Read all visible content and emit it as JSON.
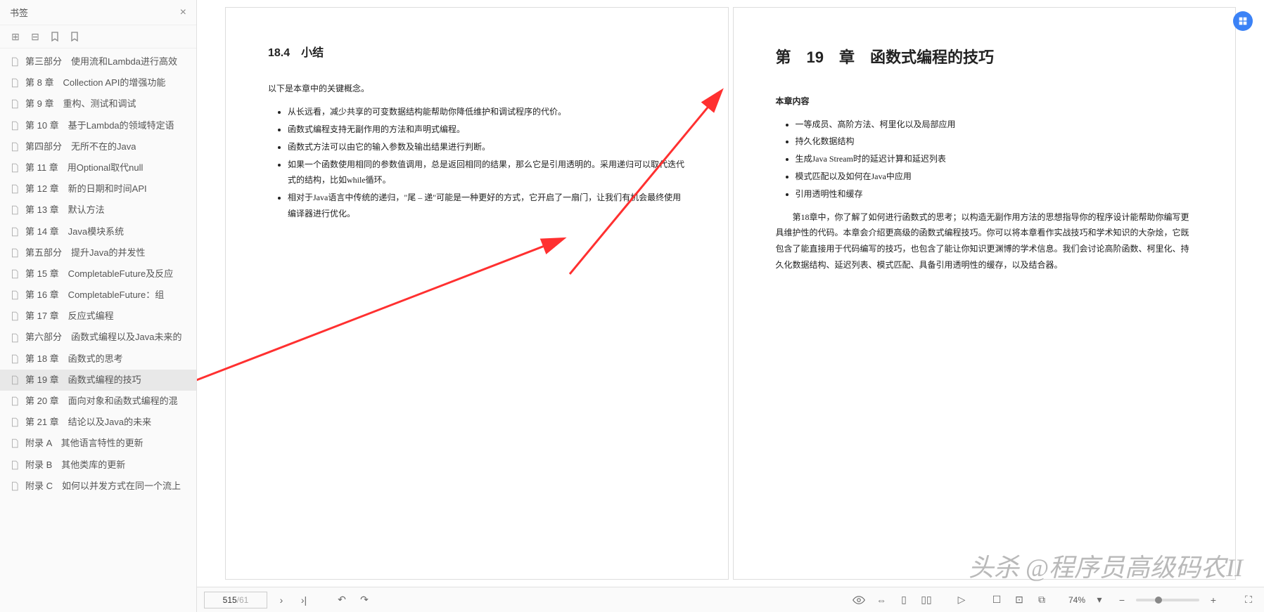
{
  "sidebar": {
    "title": "书签",
    "items": [
      {
        "label": "第三部分　使用流和Lambda进行高效"
      },
      {
        "label": "第 8 章　Collection API的增强功能"
      },
      {
        "label": "第 9 章　重构、测试和调试"
      },
      {
        "label": "第 10 章　基于Lambda的领域特定语"
      },
      {
        "label": "第四部分　无所不在的Java"
      },
      {
        "label": "第 11 章　用Optional取代null"
      },
      {
        "label": "第 12 章　新的日期和时间API"
      },
      {
        "label": "第 13 章　默认方法"
      },
      {
        "label": "第 14 章　Java模块系统"
      },
      {
        "label": "第五部分　提升Java的并发性"
      },
      {
        "label": "第 15 章　CompletableFuture及反应"
      },
      {
        "label": "第 16 章　CompletableFuture：组"
      },
      {
        "label": "第 17 章　反应式编程"
      },
      {
        "label": "第六部分　函数式编程以及Java未来的"
      },
      {
        "label": "第 18 章　函数式的思考"
      },
      {
        "label": "第 19 章　函数式编程的技巧"
      },
      {
        "label": "第 20 章　面向对象和函数式编程的混"
      },
      {
        "label": "第 21 章　结论以及Java的未来"
      },
      {
        "label": "附录 A　其他语言特性的更新"
      },
      {
        "label": "附录 B　其他类库的更新"
      },
      {
        "label": "附录 C　如何以并发方式在同一个流上"
      }
    ],
    "active_index": 15
  },
  "page_left": {
    "heading": "18.4　小结",
    "intro": "以下是本章中的关键概念。",
    "bullets": [
      "从长远看，减少共享的可变数据结构能帮助你降低维护和调试程序的代价。",
      "函数式编程支持无副作用的方法和声明式编程。",
      "函数式方法可以由它的输入参数及输出结果进行判断。",
      "如果一个函数使用相同的参数值调用，总是返回相同的结果，那么它是引用透明的。采用递归可以取代迭代式的结构，比如while循环。",
      "相对于Java语言中传统的递归，\"尾 – 递\"可能是一种更好的方式，它开启了一扇门，让我们有机会最终使用编译器进行优化。"
    ]
  },
  "page_right": {
    "heading": "第　19　章　函数式编程的技巧",
    "sub": "本章内容",
    "bullets": [
      "一等成员、高阶方法、柯里化以及局部应用",
      "持久化数据结构",
      "生成Java Stream时的延迟计算和延迟列表",
      "模式匹配以及如何在Java中应用",
      "引用透明性和缓存"
    ],
    "para": "第18章中，你了解了如何进行函数式的思考；以构造无副作用方法的思想指导你的程序设计能帮助你编写更具维护性的代码。本章会介绍更高级的函数式编程技巧。你可以将本章看作实战技巧和学术知识的大杂烩，它既包含了能直接用于代码编写的技巧，也包含了能让你知识更渊博的学术信息。我们会讨论高阶函数、柯里化、持久化数据结构、延迟列表、模式匹配、具备引用透明性的缓存，以及结合器。"
  },
  "footer": {
    "current_page": "515",
    "total_pages": "/61",
    "zoom": "74%"
  },
  "watermark": "头杀 @程序员高级码农II"
}
